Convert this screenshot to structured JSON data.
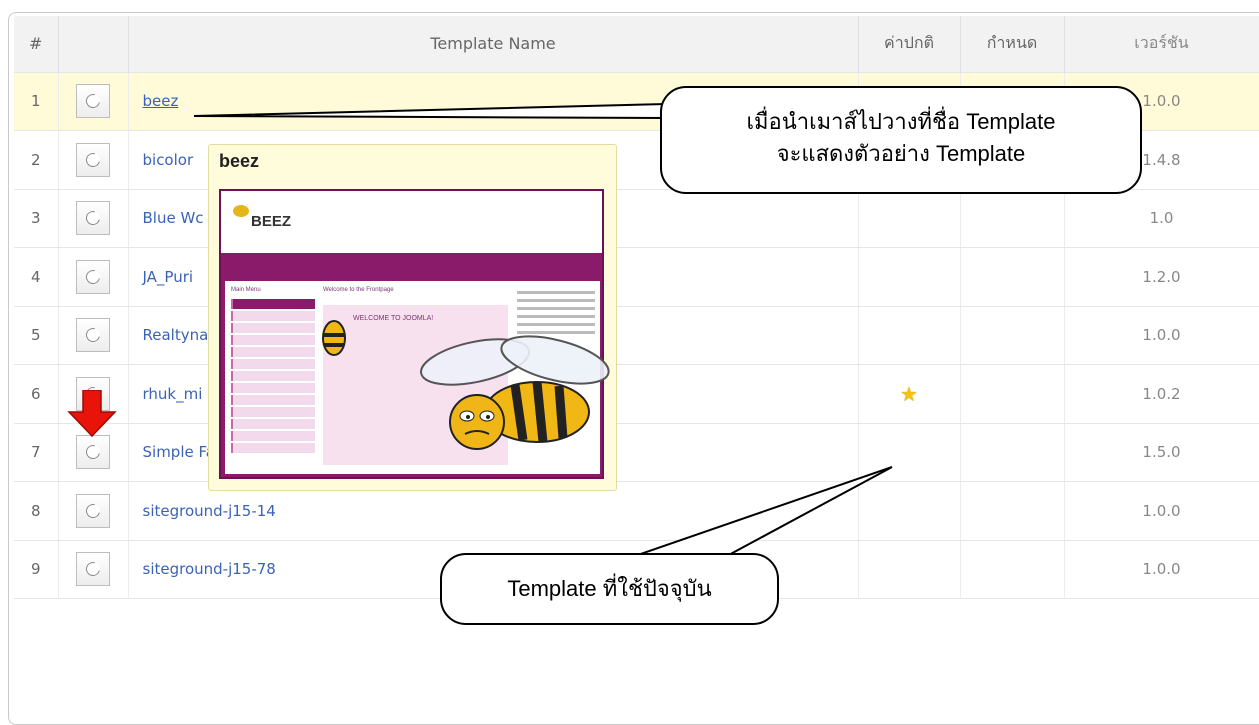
{
  "table": {
    "headers": {
      "num": "#",
      "name": "Template Name",
      "default": "ค่าปกติ",
      "assigned": "กำหนด",
      "version": "เวอร์ชัน"
    },
    "rows": [
      {
        "num": "1",
        "name": "beez",
        "version": "1.0.0",
        "highlighted": true
      },
      {
        "num": "2",
        "name": "bicolor",
        "version": "1.4.8"
      },
      {
        "num": "3",
        "name": "Blue Wc",
        "version": "1.0"
      },
      {
        "num": "4",
        "name": "JA_Puri",
        "version": "1.2.0"
      },
      {
        "num": "5",
        "name": "Realtyna",
        "version": "1.0.0"
      },
      {
        "num": "6",
        "name": "rhuk_mi",
        "version": "1.0.2",
        "default": "star-icon"
      },
      {
        "num": "7",
        "name": "Simple Fast",
        "version": "1.5.0"
      },
      {
        "num": "8",
        "name": "siteground-j15-14",
        "version": "1.0.0"
      },
      {
        "num": "9",
        "name": "siteground-j15-78",
        "version": "1.0.0"
      }
    ]
  },
  "preview": {
    "title": "beez",
    "screenshot": {
      "logo": "BEEZ",
      "welcome": "Welcome to the Frontpage",
      "inner_heading": "WELCOME TO JOOMLA!",
      "side_title": "Main Menu"
    }
  },
  "callouts": {
    "hover_line1": "เมื่อนำเมาส์ไปวางที่ชื่อ Template",
    "hover_line2": "จะแสดงตัวอย่าง Template",
    "current": "Template ที่ใช้ปัจจุบัน"
  },
  "colors": {
    "highlight_row": "#fffbd8",
    "link": "#3a63b8",
    "arrow": "#e8140a",
    "star": "#f2c40f"
  }
}
